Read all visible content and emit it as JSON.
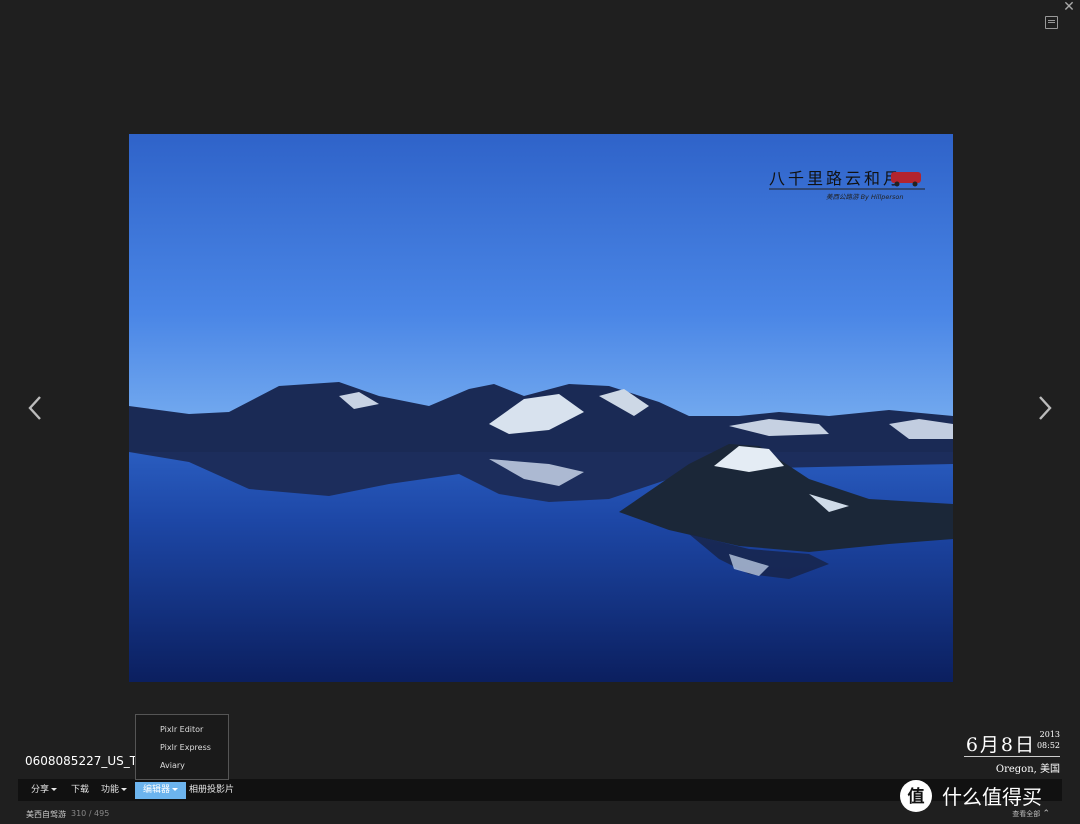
{
  "photo": {
    "watermark_title": "八千里路云和月",
    "watermark_subtitle": "美西公路游 By Hillperson"
  },
  "title": "0608085227_US_T",
  "date": {
    "main": "6月8日",
    "year": "2013",
    "time": "08:52",
    "location": "Oregon, 美国"
  },
  "toolbar": {
    "share_label": "分享",
    "download_label": "下载",
    "functions_label": "功能",
    "editor_label": "编辑器",
    "slideshow_label": "相册投影片"
  },
  "editor_menu": {
    "items": [
      "Pixlr Editor",
      "Pixlr Express",
      "Aviary"
    ]
  },
  "album": {
    "name": "美西自驾游",
    "count": "310 / 495",
    "view_all_label": "查看全部"
  },
  "site_logo": {
    "text": "什么值得买"
  },
  "colors": {
    "background": "#1f1f1f",
    "toolbar": "#111111",
    "accent": "#6cb4ee"
  }
}
